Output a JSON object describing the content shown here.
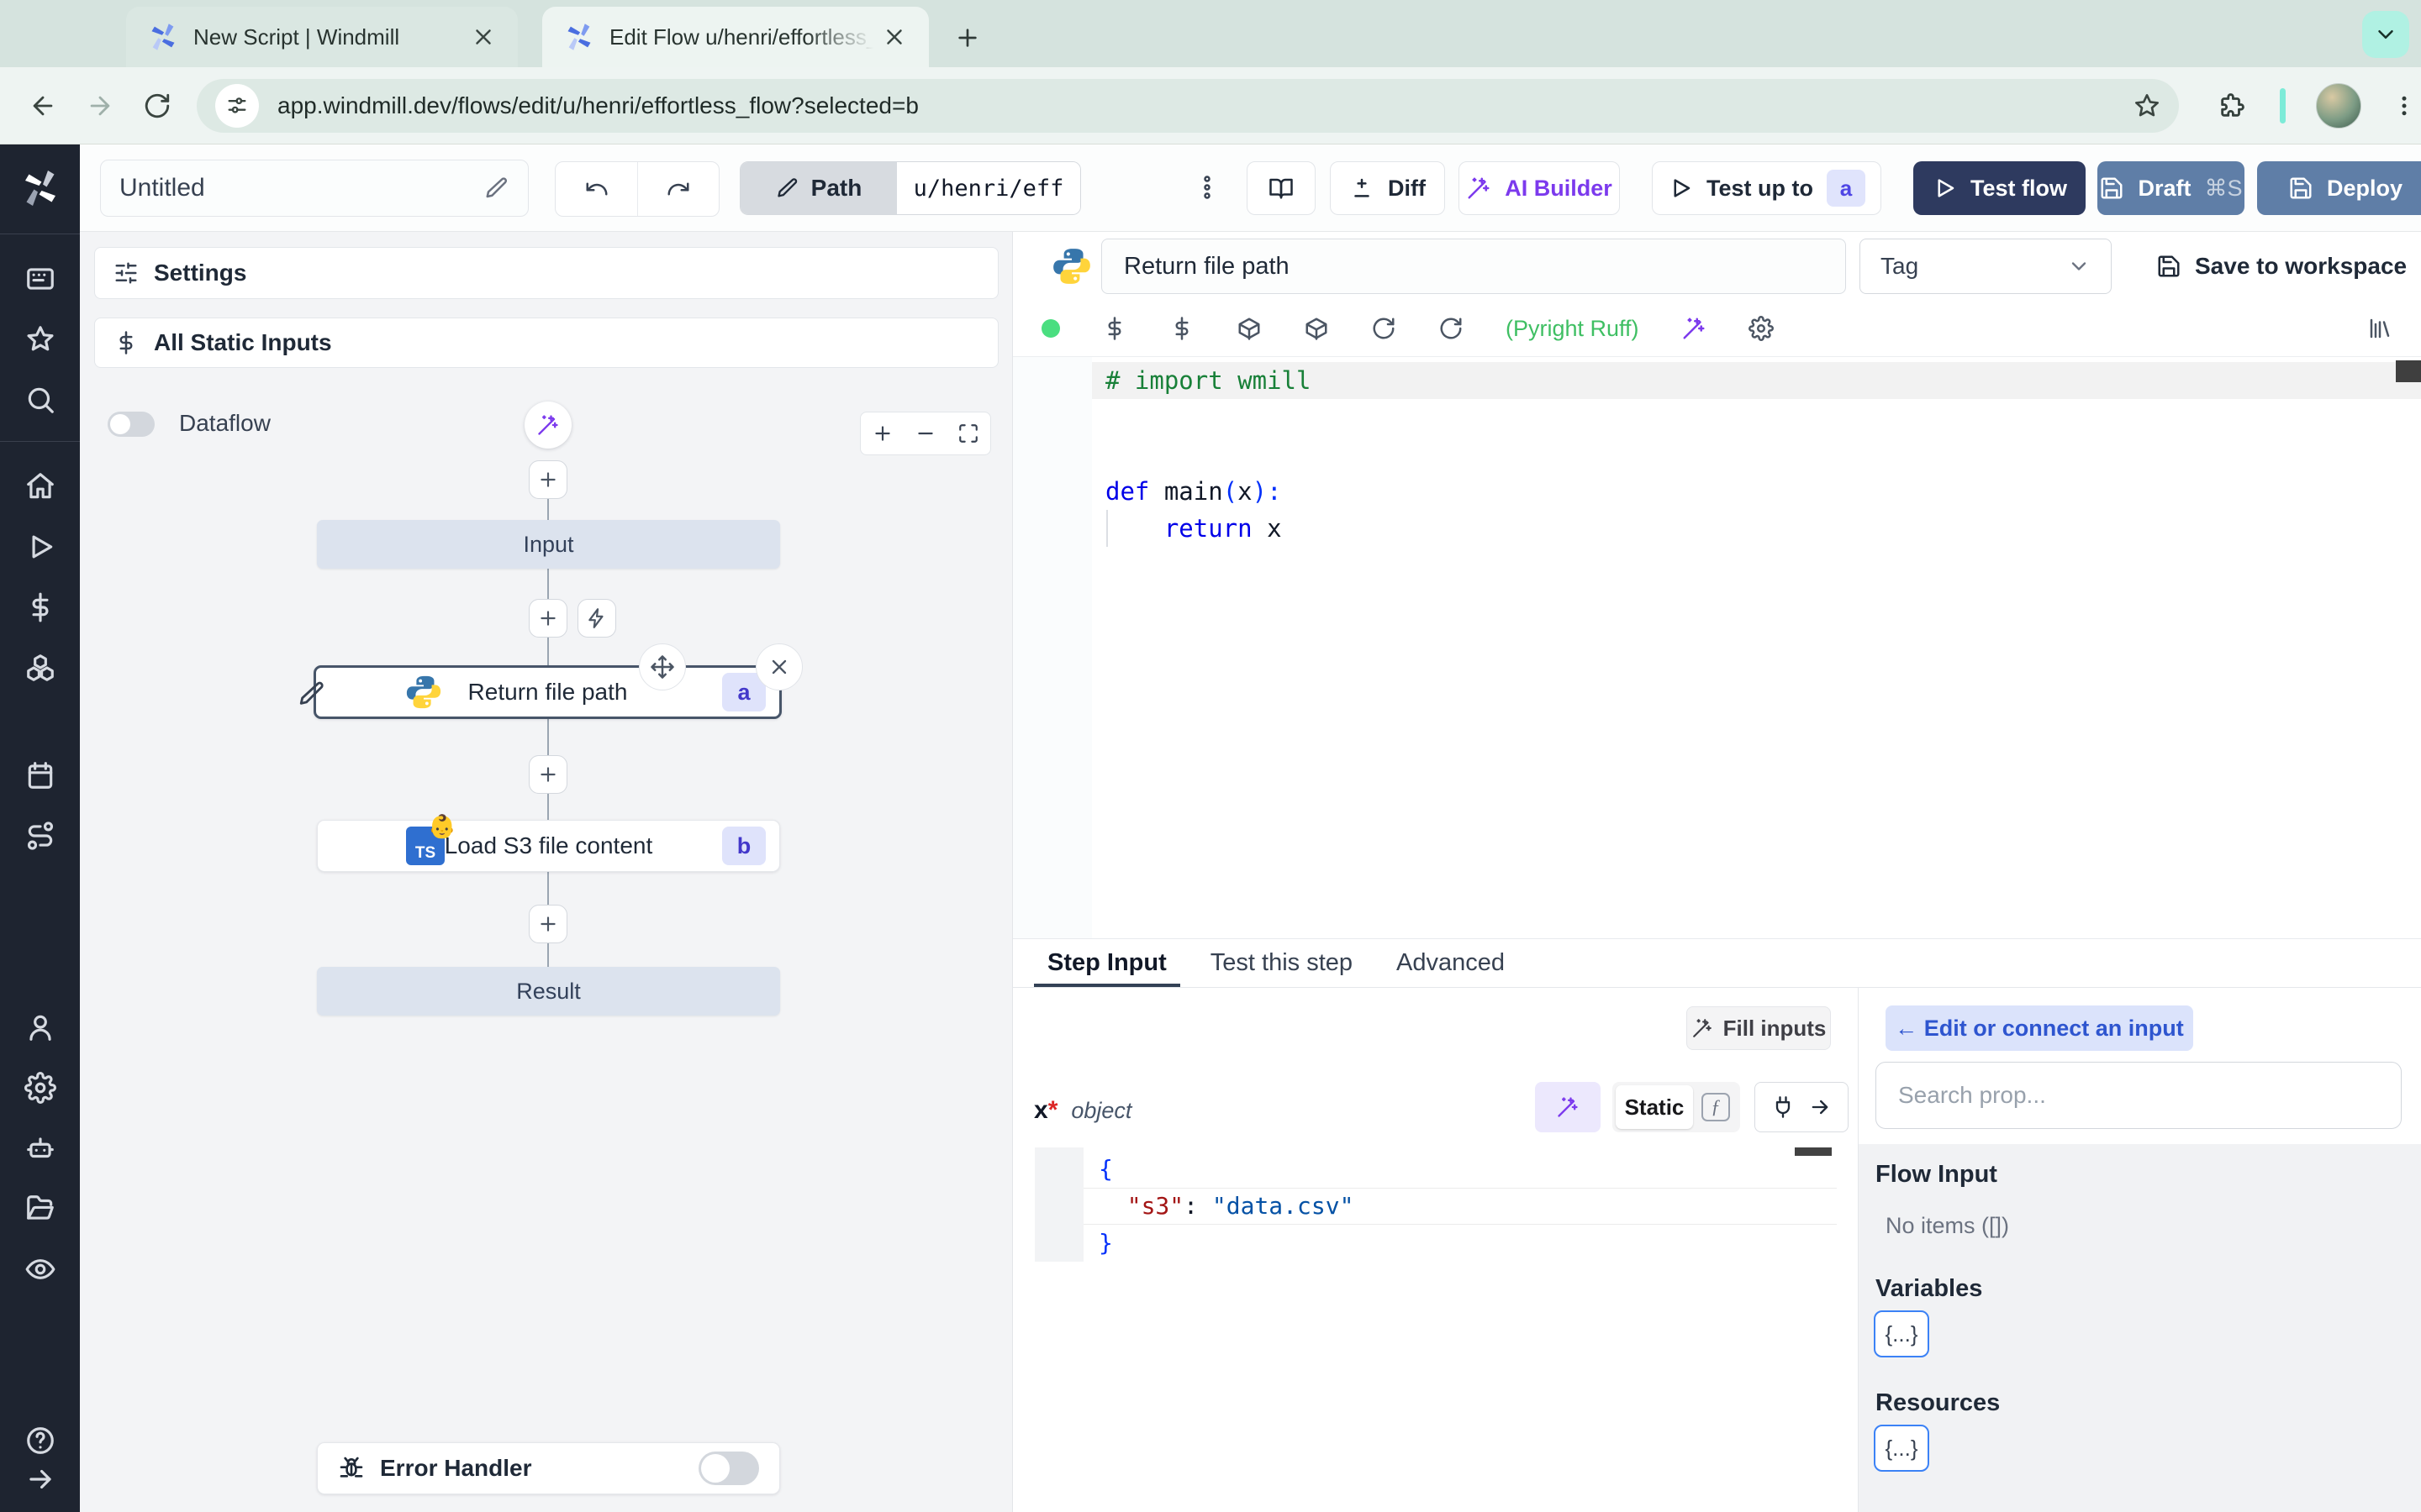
{
  "browser": {
    "tab1_title": "New Script | Windmill",
    "tab2_title": "Edit Flow u/henri/effortless_fl",
    "url": "app.windmill.dev/flows/edit/u/henri/effortless_flow?selected=b"
  },
  "header": {
    "name": "Untitled",
    "path_label": "Path",
    "path_value": "u/henri/eff",
    "diff": "Diff",
    "ai_builder": "AI Builder",
    "test_up_to": "Test up to",
    "test_up_to_badge": "a",
    "test_flow": "Test flow",
    "draft": "Draft",
    "draft_shortcut": "⌘S",
    "deploy": "Deploy"
  },
  "flow": {
    "settings": "Settings",
    "all_static_inputs": "All Static Inputs",
    "dataflow": "Dataflow",
    "nodes": {
      "input": "Input",
      "step_a_label": "Return file path",
      "step_a_badge": "a",
      "step_b_label": "Load S3 file content",
      "step_b_badge": "b",
      "step_b_icon_text": "TS",
      "step_b_emoji": "👶",
      "result": "Result"
    },
    "error_handler": "Error Handler"
  },
  "editor": {
    "script_name": "Return file path",
    "tag_placeholder": "Tag",
    "save_to_workspace": "Save to workspace",
    "lint": "(Pyright Ruff)",
    "code": {
      "l1": "# import wmill",
      "l4_kw": "def",
      "l4_name": " main",
      "l4_p1": "(",
      "l4_arg": "x",
      "l4_p2": "):",
      "l5_indent": "    ",
      "l5_kw": "return",
      "l5_rest": " x"
    }
  },
  "tabs": {
    "step_input": "Step Input",
    "test_this_step": "Test this step",
    "advanced": "Advanced"
  },
  "step_input": {
    "fill_inputs": "Fill inputs",
    "arg_name": "x",
    "arg_required": "*",
    "arg_type": "object",
    "static_label": "Static",
    "fn_symbol": "ƒ",
    "json_l1": "{",
    "json_l2_key": "\"s3\"",
    "json_l2_colon": ": ",
    "json_l2_val": "\"data.csv\"",
    "json_l3": "}"
  },
  "connect": {
    "edit_button": "← Edit or connect an input",
    "search_placeholder": "Search prop...",
    "flow_input": "Flow Input",
    "no_items": "No items ([])",
    "variables": "Variables",
    "resources": "Resources",
    "braces": "{...}"
  },
  "colors": {
    "accent_purple": "#7c3aed",
    "accent_indigo": "#4f46e5",
    "test_flow_navy": "#2e3a5f",
    "draft_steel": "#5f7ea7",
    "lint_green": "#3fbf63",
    "sidebar_dark": "#1e2430",
    "edit_connect_blue": "#2e55cf"
  },
  "icons": {
    "windmill_logo": "pinwheel",
    "plus": "+",
    "close": "×",
    "kebab": "⋮",
    "chevron_down": "⌄",
    "arrow_left": "←",
    "arrow_right": "→"
  }
}
